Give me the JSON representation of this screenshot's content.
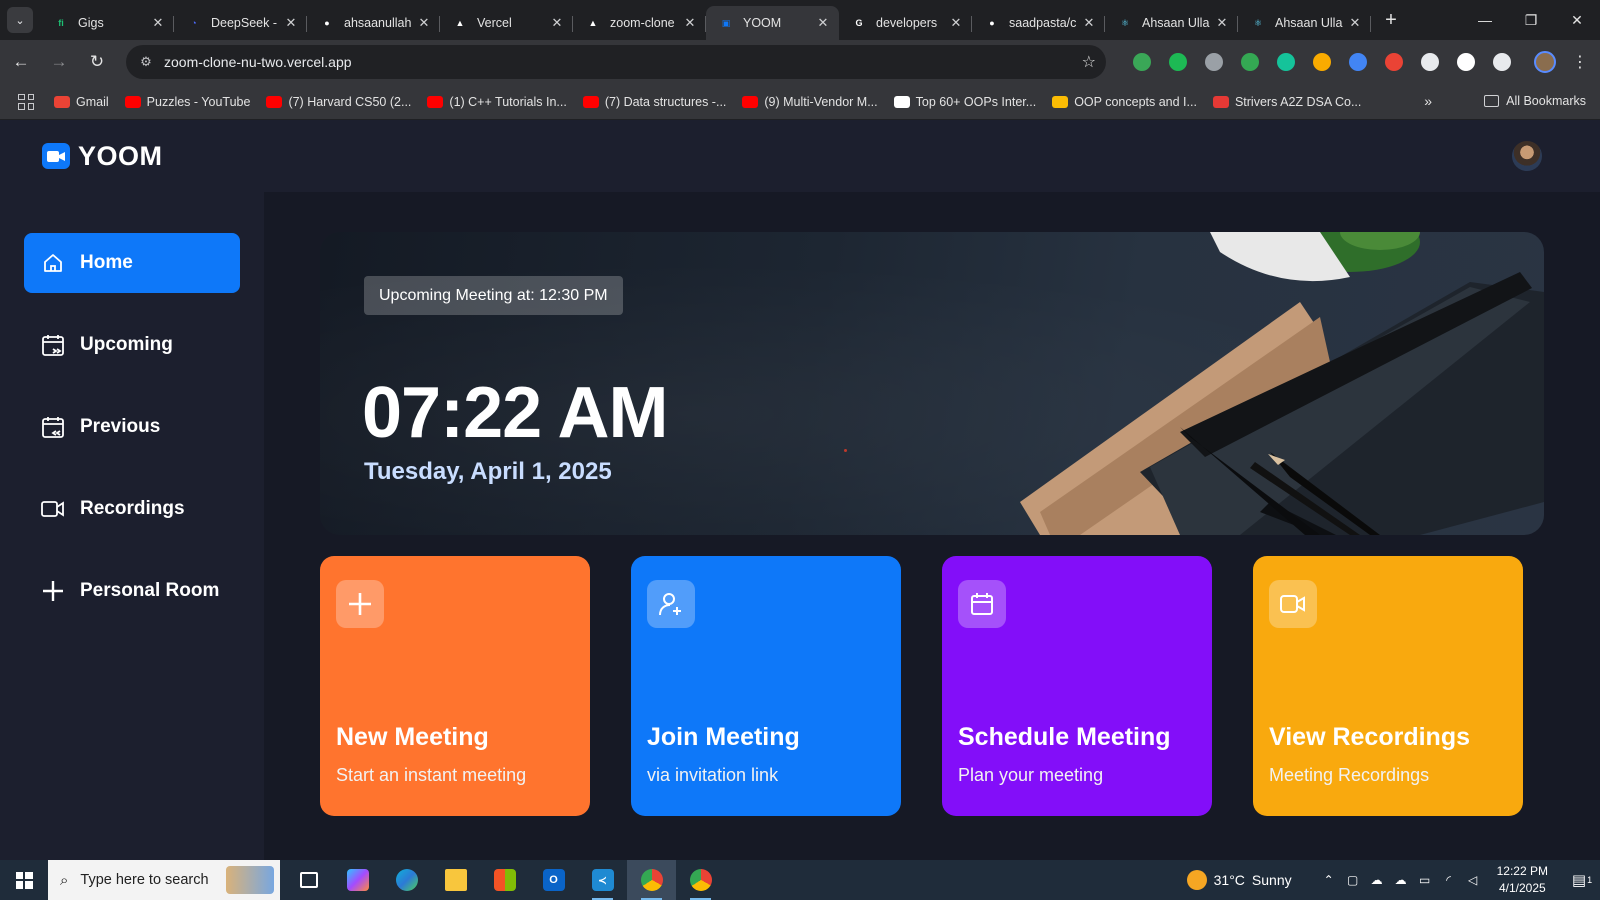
{
  "browser": {
    "tabs": [
      {
        "title": "Gigs",
        "icon": "fiverr-favicon",
        "color": "#1dbf73",
        "glyph": "fi",
        "active": false
      },
      {
        "title": "DeepSeek -",
        "icon": "deepseek-favicon",
        "color": "#4d6bfe",
        "glyph": "◔",
        "active": false
      },
      {
        "title": "ahsaanullah",
        "icon": "github-favicon",
        "color": "#ffffff",
        "glyph": "●",
        "active": false
      },
      {
        "title": "Vercel",
        "icon": "vercel-favicon",
        "color": "#ffffff",
        "glyph": "▲",
        "active": false
      },
      {
        "title": "zoom-clone",
        "icon": "vercel-favicon",
        "color": "#ffffff",
        "glyph": "▲",
        "active": false
      },
      {
        "title": "YOOM",
        "icon": "yoom-favicon",
        "color": "#0e78f9",
        "glyph": "▣",
        "active": true
      },
      {
        "title": "developers",
        "icon": "google-favicon",
        "color": "#ffffff",
        "glyph": "G",
        "active": false
      },
      {
        "title": "saadpasta/c",
        "icon": "github-favicon",
        "color": "#ffffff",
        "glyph": "●",
        "active": false
      },
      {
        "title": "Ahsaan Ulla",
        "icon": "react-favicon",
        "color": "#61dafb",
        "glyph": "⚛",
        "active": false
      },
      {
        "title": "Ahsaan Ulla",
        "icon": "react-favicon",
        "color": "#61dafb",
        "glyph": "⚛",
        "active": false
      }
    ],
    "new_tab": "+",
    "address": "zoom-clone-nu-two.vercel.app",
    "bookmarks": [
      {
        "label": "Gmail",
        "color": "#ea4335"
      },
      {
        "label": "Puzzles - YouTube",
        "color": "#ff0000"
      },
      {
        "label": "(7) Harvard CS50 (2...",
        "color": "#ff0000"
      },
      {
        "label": "(1) C++ Tutorials In...",
        "color": "#ff0000"
      },
      {
        "label": "(7) Data structures -...",
        "color": "#ff0000"
      },
      {
        "label": "(9) Multi-Vendor M...",
        "color": "#ff0000"
      },
      {
        "label": "Top 60+ OOPs Inter...",
        "color": "#ffffff"
      },
      {
        "label": "OOP concepts and I...",
        "color": "#fbbc04"
      },
      {
        "label": "Strivers A2Z DSA Co...",
        "color": "#e53935"
      }
    ],
    "all_bookmarks": "All Bookmarks",
    "extensions": [
      "#3aa757",
      "#1db954",
      "#9aa0a6",
      "#34a853",
      "#15c39a",
      "#f9ab00",
      "#4285f4",
      "#ea4335",
      "#e8eaed",
      "#ffffff",
      "#e8eaed"
    ]
  },
  "app": {
    "brand": "YOOM",
    "accent": "#0e78f9",
    "nav": [
      {
        "label": "Home",
        "icon": "home-icon",
        "active": true
      },
      {
        "label": "Upcoming",
        "icon": "calendar-upcoming-icon",
        "active": false
      },
      {
        "label": "Previous",
        "icon": "calendar-previous-icon",
        "active": false
      },
      {
        "label": "Recordings",
        "icon": "video-icon",
        "active": false
      },
      {
        "label": "Personal Room",
        "icon": "plus-icon",
        "active": false
      }
    ],
    "hero": {
      "upcoming": "Upcoming Meeting at: 12:30 PM",
      "time": "07:22 AM",
      "date": "Tuesday, April 1, 2025"
    },
    "cards": [
      {
        "title": "New Meeting",
        "subtitle": "Start an instant meeting",
        "color": "#ff742e",
        "icon": "plus-icon"
      },
      {
        "title": "Join Meeting",
        "subtitle": "via invitation link",
        "color": "#0e78f9",
        "icon": "add-user-icon"
      },
      {
        "title": "Schedule Meeting",
        "subtitle": "Plan your meeting",
        "color": "#830ef9",
        "icon": "calendar-icon"
      },
      {
        "title": "View Recordings",
        "subtitle": "Meeting Recordings",
        "color": "#f9a90e",
        "icon": "video-icon"
      }
    ]
  },
  "taskbar": {
    "search_placeholder": "Type here to search",
    "weather_temp": "31°C",
    "weather_text": "Sunny",
    "time": "12:22 PM",
    "date": "4/1/2025",
    "notifications": "1"
  }
}
